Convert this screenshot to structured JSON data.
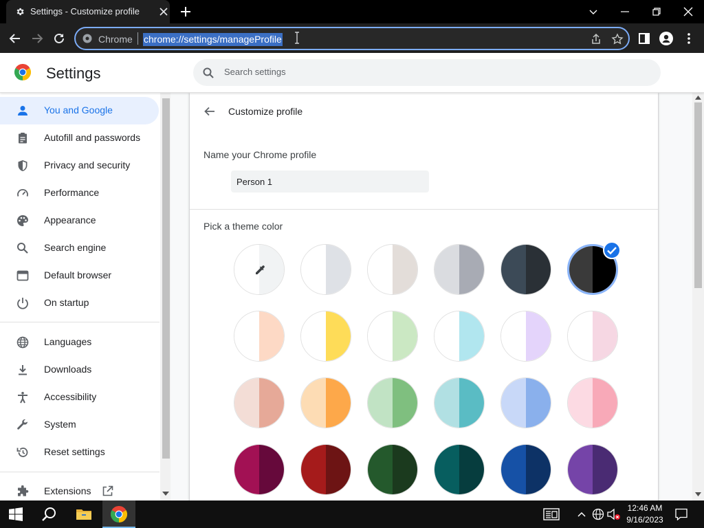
{
  "browser": {
    "tab_title": "Settings - Customize profile",
    "omnibox_site": "Chrome",
    "omnibox_url": "chrome://settings/manageProfile",
    "accent": "#7cacf8"
  },
  "header": {
    "title": "Settings",
    "search_placeholder": "Search settings"
  },
  "sidebar": {
    "items": [
      {
        "label": "You and Google",
        "icon": "person-icon",
        "active": true
      },
      {
        "label": "Autofill and passwords",
        "icon": "clipboard-icon"
      },
      {
        "label": "Privacy and security",
        "icon": "shield-icon"
      },
      {
        "label": "Performance",
        "icon": "speedometer-icon"
      },
      {
        "label": "Appearance",
        "icon": "palette-icon"
      },
      {
        "label": "Search engine",
        "icon": "magnifier-icon"
      },
      {
        "label": "Default browser",
        "icon": "browser-window-icon"
      },
      {
        "label": "On startup",
        "icon": "power-icon"
      },
      {
        "label": "Languages",
        "icon": "globe-icon"
      },
      {
        "label": "Downloads",
        "icon": "download-icon"
      },
      {
        "label": "Accessibility",
        "icon": "accessibility-icon"
      },
      {
        "label": "System",
        "icon": "wrench-icon"
      },
      {
        "label": "Reset settings",
        "icon": "reset-icon"
      },
      {
        "label": "Extensions",
        "icon": "puzzle-icon"
      }
    ],
    "active_color": "#1a73e8"
  },
  "main": {
    "subpage_title": "Customize profile",
    "name_label": "Name your Chrome profile",
    "name_value": "Person 1",
    "theme_label": "Pick a theme color",
    "theme_colors": [
      {
        "name": "custom-picker",
        "left": "#ffffff",
        "right": "#f1f3f4"
      },
      {
        "name": "default",
        "left": "#ffffff",
        "right": "#dee1e6"
      },
      {
        "name": "warm-grey",
        "left": "#ffffff",
        "right": "#e3ddd9"
      },
      {
        "name": "cool-grey",
        "left": "#dadce0",
        "right": "#a8abb4"
      },
      {
        "name": "midnight-blue",
        "left": "#3c4a57",
        "right": "#2a3036"
      },
      {
        "name": "black",
        "left": "#3a3a3a",
        "right": "#000000",
        "selected": true
      },
      {
        "name": "beige-white",
        "left": "#ffffff",
        "right": "#fdd9c5"
      },
      {
        "name": "yellow-white",
        "left": "#ffffff",
        "right": "#fedc58"
      },
      {
        "name": "green-white",
        "left": "#ffffff",
        "right": "#cbe8c3"
      },
      {
        "name": "light-teal-white",
        "left": "#ffffff",
        "right": "#b1e6ef"
      },
      {
        "name": "light-purple-white",
        "left": "#ffffff",
        "right": "#e4d4fb"
      },
      {
        "name": "pink-white",
        "left": "#ffffff",
        "right": "#f6d7e3"
      },
      {
        "name": "beige",
        "left": "#f3ddd6",
        "right": "#e6a998"
      },
      {
        "name": "orange",
        "left": "#fddcb4",
        "right": "#fda84a"
      },
      {
        "name": "light-green",
        "left": "#c1e3c4",
        "right": "#7fbf7f"
      },
      {
        "name": "light-teal",
        "left": "#b1e0e3",
        "right": "#5abcc4"
      },
      {
        "name": "light-blue",
        "left": "#c8d8f8",
        "right": "#8ab0ec"
      },
      {
        "name": "light-pink",
        "left": "#fcdae3",
        "right": "#f8a9b8"
      },
      {
        "name": "dark-pink",
        "left": "#a21154",
        "right": "#66093b"
      },
      {
        "name": "dark-red",
        "left": "#a51b1b",
        "right": "#6d1414"
      },
      {
        "name": "dark-green",
        "left": "#24592c",
        "right": "#1b3a1e"
      },
      {
        "name": "dark-teal",
        "left": "#075e5f",
        "right": "#063d3e"
      },
      {
        "name": "dark-blue",
        "left": "#1651a6",
        "right": "#0d3266"
      },
      {
        "name": "purple",
        "left": "#7544a8",
        "right": "#4a2b73"
      }
    ]
  },
  "taskbar": {
    "time": "12:46 AM",
    "date": "9/16/2023"
  }
}
